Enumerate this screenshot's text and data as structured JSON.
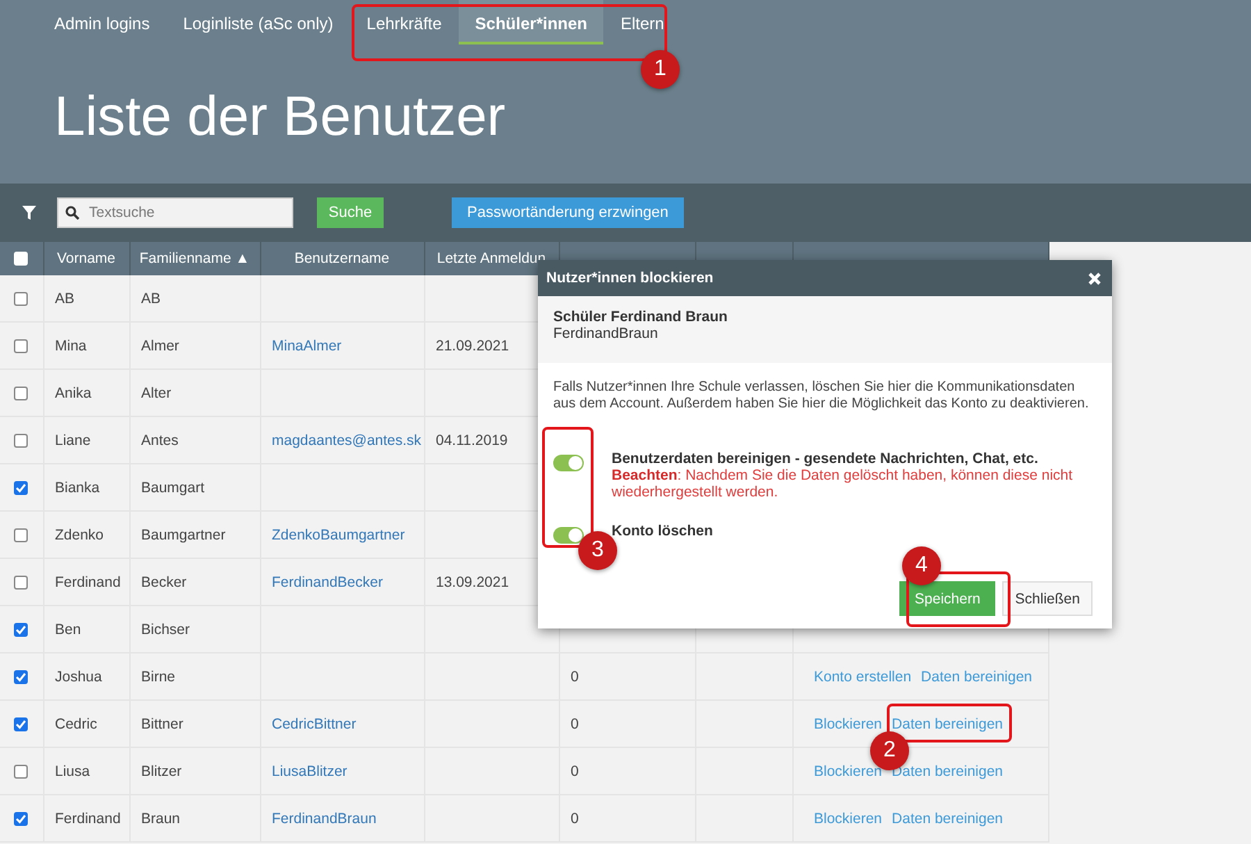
{
  "nav": {
    "tabs": [
      {
        "label": "Admin logins",
        "selected": false
      },
      {
        "label": "Loginliste (aSc only)",
        "selected": false
      },
      {
        "label": "Lehrkräfte",
        "selected": false
      },
      {
        "label": "Schüler*innen",
        "selected": true
      },
      {
        "label": "Eltern",
        "selected": false
      }
    ]
  },
  "page_title": "Liste der Benutzer",
  "toolbar": {
    "search": {
      "placeholder": "Textsuche"
    },
    "search_button": "Suche",
    "force_password_button": "Passwortänderung erzwingen"
  },
  "table": {
    "select_all_checked": false,
    "columns": [
      "Vorname",
      "Familienname ▲",
      "Benutzername",
      "Letzte Anmeldun"
    ],
    "rows": [
      {
        "checked": false,
        "first_name": "AB",
        "last_name": "AB"
      },
      {
        "checked": false,
        "first_name": "Mina",
        "last_name": "Almer",
        "username": "MinaAlmer",
        "last_login": "21.09.2021"
      },
      {
        "checked": false,
        "first_name": "Anika",
        "last_name": "Alter"
      },
      {
        "checked": false,
        "first_name": "Liane",
        "last_name": "Antes",
        "username": "magdaantes@antes.sk",
        "last_login": "04.11.2019"
      },
      {
        "checked": true,
        "first_name": "Bianka",
        "last_name": "Baumgart"
      },
      {
        "checked": false,
        "first_name": "Zdenko",
        "last_name": "Baumgartner",
        "username": "ZdenkoBaumgartner"
      },
      {
        "checked": false,
        "first_name": "Ferdinand",
        "last_name": "Becker",
        "username": "FerdinandBecker",
        "last_login": "13.09.2021"
      },
      {
        "checked": true,
        "first_name": "Ben",
        "last_name": "Bichser"
      },
      {
        "checked": true,
        "first_name": "Joshua",
        "last_name": "Birne",
        "logins": "0",
        "actions": [
          "Konto erstellen",
          "Daten bereinigen"
        ]
      },
      {
        "checked": true,
        "first_name": "Cedric",
        "last_name": "Bittner",
        "username": "CedricBittner",
        "logins": "0",
        "actions": [
          "Blockieren",
          "Daten bereinigen"
        ]
      },
      {
        "checked": false,
        "first_name": "Liusa",
        "last_name": "Blitzer",
        "username": "LiusaBlitzer",
        "logins": "0",
        "actions": [
          "Blockieren",
          "Daten bereinigen"
        ]
      },
      {
        "checked": true,
        "first_name": "Ferdinand",
        "last_name": "Braun",
        "username": "FerdinandBraun",
        "logins": "0",
        "actions": [
          "Blockieren",
          "Daten bereinigen"
        ]
      }
    ]
  },
  "dialog": {
    "title": "Nutzer*innen blockieren",
    "user_name": "Schüler Ferdinand Braun",
    "user_login": "FerdinandBraun",
    "description": "Falls Nutzer*innen Ihre Schule verlassen, löschen Sie hier die Kommunikationsdaten aus dem Account. Außerdem haben Sie hier die Möglichkeit das Konto zu deaktivieren.",
    "options": [
      {
        "label": "Benutzerdaten bereinigen - gesendete Nachrichten, Chat, etc.",
        "warning": "**Beachten**: Nachdem Sie die Daten gelöscht haben, können diese nicht wiederhergestellt werden.",
        "on": true
      },
      {
        "label": "Konto löschen",
        "on": true
      }
    ],
    "buttons": [
      {
        "label": "Speichern",
        "kind": "primary"
      },
      {
        "label": "Schließen",
        "kind": "default"
      }
    ]
  },
  "annotations": [
    "1",
    "2",
    "3",
    "4"
  ]
}
